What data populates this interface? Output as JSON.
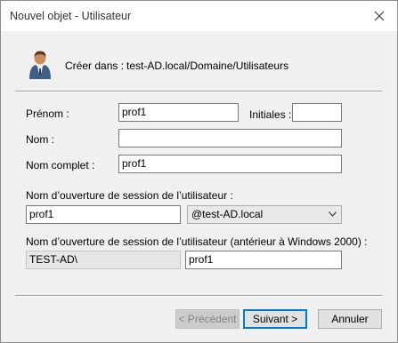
{
  "window": {
    "title": "Nouvel objet - Utilisateur",
    "close_icon": "close-icon"
  },
  "header": {
    "create_in_label": "Créer dans :",
    "create_in_path": "test-AD.local/Domaine/Utilisateurs",
    "icon": "user-icon"
  },
  "form": {
    "first_name_label": "Prénom :",
    "first_name_value": "prof1",
    "initials_label": "Initiales :",
    "initials_value": "",
    "last_name_label": "Nom :",
    "last_name_value": "",
    "full_name_label": "Nom complet :",
    "full_name_value": "prof1",
    "logon_name_label": "Nom d’ouverture de session de l’utilisateur :",
    "logon_name_value": "prof1",
    "domain_suffix_value": "@test-AD.local",
    "legacy_logon_label": "Nom d’ouverture de session de l’utilisateur (antérieur à Windows 2000) :",
    "legacy_domain_value": "TEST-AD\\",
    "legacy_logon_value": "prof1"
  },
  "buttons": {
    "previous": "< Précédent",
    "next": "Suivant >",
    "cancel": "Annuler"
  }
}
